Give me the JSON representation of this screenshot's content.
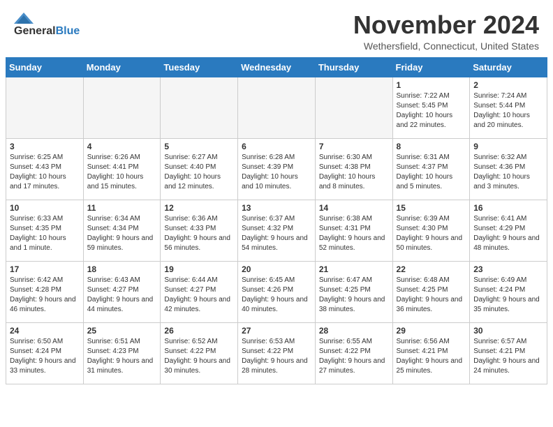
{
  "header": {
    "logo_line1": "General",
    "logo_line2": "Blue",
    "month_title": "November 2024",
    "location": "Wethersfield, Connecticut, United States"
  },
  "days_of_week": [
    "Sunday",
    "Monday",
    "Tuesday",
    "Wednesday",
    "Thursday",
    "Friday",
    "Saturday"
  ],
  "weeks": [
    [
      {
        "day": "",
        "empty": true
      },
      {
        "day": "",
        "empty": true
      },
      {
        "day": "",
        "empty": true
      },
      {
        "day": "",
        "empty": true
      },
      {
        "day": "",
        "empty": true
      },
      {
        "day": "1",
        "sunrise": "Sunrise: 7:22 AM",
        "sunset": "Sunset: 5:45 PM",
        "daylight": "Daylight: 10 hours and 22 minutes."
      },
      {
        "day": "2",
        "sunrise": "Sunrise: 7:24 AM",
        "sunset": "Sunset: 5:44 PM",
        "daylight": "Daylight: 10 hours and 20 minutes."
      }
    ],
    [
      {
        "day": "3",
        "sunrise": "Sunrise: 6:25 AM",
        "sunset": "Sunset: 4:43 PM",
        "daylight": "Daylight: 10 hours and 17 minutes."
      },
      {
        "day": "4",
        "sunrise": "Sunrise: 6:26 AM",
        "sunset": "Sunset: 4:41 PM",
        "daylight": "Daylight: 10 hours and 15 minutes."
      },
      {
        "day": "5",
        "sunrise": "Sunrise: 6:27 AM",
        "sunset": "Sunset: 4:40 PM",
        "daylight": "Daylight: 10 hours and 12 minutes."
      },
      {
        "day": "6",
        "sunrise": "Sunrise: 6:28 AM",
        "sunset": "Sunset: 4:39 PM",
        "daylight": "Daylight: 10 hours and 10 minutes."
      },
      {
        "day": "7",
        "sunrise": "Sunrise: 6:30 AM",
        "sunset": "Sunset: 4:38 PM",
        "daylight": "Daylight: 10 hours and 8 minutes."
      },
      {
        "day": "8",
        "sunrise": "Sunrise: 6:31 AM",
        "sunset": "Sunset: 4:37 PM",
        "daylight": "Daylight: 10 hours and 5 minutes."
      },
      {
        "day": "9",
        "sunrise": "Sunrise: 6:32 AM",
        "sunset": "Sunset: 4:36 PM",
        "daylight": "Daylight: 10 hours and 3 minutes."
      }
    ],
    [
      {
        "day": "10",
        "sunrise": "Sunrise: 6:33 AM",
        "sunset": "Sunset: 4:35 PM",
        "daylight": "Daylight: 10 hours and 1 minute."
      },
      {
        "day": "11",
        "sunrise": "Sunrise: 6:34 AM",
        "sunset": "Sunset: 4:34 PM",
        "daylight": "Daylight: 9 hours and 59 minutes."
      },
      {
        "day": "12",
        "sunrise": "Sunrise: 6:36 AM",
        "sunset": "Sunset: 4:33 PM",
        "daylight": "Daylight: 9 hours and 56 minutes."
      },
      {
        "day": "13",
        "sunrise": "Sunrise: 6:37 AM",
        "sunset": "Sunset: 4:32 PM",
        "daylight": "Daylight: 9 hours and 54 minutes."
      },
      {
        "day": "14",
        "sunrise": "Sunrise: 6:38 AM",
        "sunset": "Sunset: 4:31 PM",
        "daylight": "Daylight: 9 hours and 52 minutes."
      },
      {
        "day": "15",
        "sunrise": "Sunrise: 6:39 AM",
        "sunset": "Sunset: 4:30 PM",
        "daylight": "Daylight: 9 hours and 50 minutes."
      },
      {
        "day": "16",
        "sunrise": "Sunrise: 6:41 AM",
        "sunset": "Sunset: 4:29 PM",
        "daylight": "Daylight: 9 hours and 48 minutes."
      }
    ],
    [
      {
        "day": "17",
        "sunrise": "Sunrise: 6:42 AM",
        "sunset": "Sunset: 4:28 PM",
        "daylight": "Daylight: 9 hours and 46 minutes."
      },
      {
        "day": "18",
        "sunrise": "Sunrise: 6:43 AM",
        "sunset": "Sunset: 4:27 PM",
        "daylight": "Daylight: 9 hours and 44 minutes."
      },
      {
        "day": "19",
        "sunrise": "Sunrise: 6:44 AM",
        "sunset": "Sunset: 4:27 PM",
        "daylight": "Daylight: 9 hours and 42 minutes."
      },
      {
        "day": "20",
        "sunrise": "Sunrise: 6:45 AM",
        "sunset": "Sunset: 4:26 PM",
        "daylight": "Daylight: 9 hours and 40 minutes."
      },
      {
        "day": "21",
        "sunrise": "Sunrise: 6:47 AM",
        "sunset": "Sunset: 4:25 PM",
        "daylight": "Daylight: 9 hours and 38 minutes."
      },
      {
        "day": "22",
        "sunrise": "Sunrise: 6:48 AM",
        "sunset": "Sunset: 4:25 PM",
        "daylight": "Daylight: 9 hours and 36 minutes."
      },
      {
        "day": "23",
        "sunrise": "Sunrise: 6:49 AM",
        "sunset": "Sunset: 4:24 PM",
        "daylight": "Daylight: 9 hours and 35 minutes."
      }
    ],
    [
      {
        "day": "24",
        "sunrise": "Sunrise: 6:50 AM",
        "sunset": "Sunset: 4:24 PM",
        "daylight": "Daylight: 9 hours and 33 minutes."
      },
      {
        "day": "25",
        "sunrise": "Sunrise: 6:51 AM",
        "sunset": "Sunset: 4:23 PM",
        "daylight": "Daylight: 9 hours and 31 minutes."
      },
      {
        "day": "26",
        "sunrise": "Sunrise: 6:52 AM",
        "sunset": "Sunset: 4:22 PM",
        "daylight": "Daylight: 9 hours and 30 minutes."
      },
      {
        "day": "27",
        "sunrise": "Sunrise: 6:53 AM",
        "sunset": "Sunset: 4:22 PM",
        "daylight": "Daylight: 9 hours and 28 minutes."
      },
      {
        "day": "28",
        "sunrise": "Sunrise: 6:55 AM",
        "sunset": "Sunset: 4:22 PM",
        "daylight": "Daylight: 9 hours and 27 minutes."
      },
      {
        "day": "29",
        "sunrise": "Sunrise: 6:56 AM",
        "sunset": "Sunset: 4:21 PM",
        "daylight": "Daylight: 9 hours and 25 minutes."
      },
      {
        "day": "30",
        "sunrise": "Sunrise: 6:57 AM",
        "sunset": "Sunset: 4:21 PM",
        "daylight": "Daylight: 9 hours and 24 minutes."
      }
    ]
  ]
}
